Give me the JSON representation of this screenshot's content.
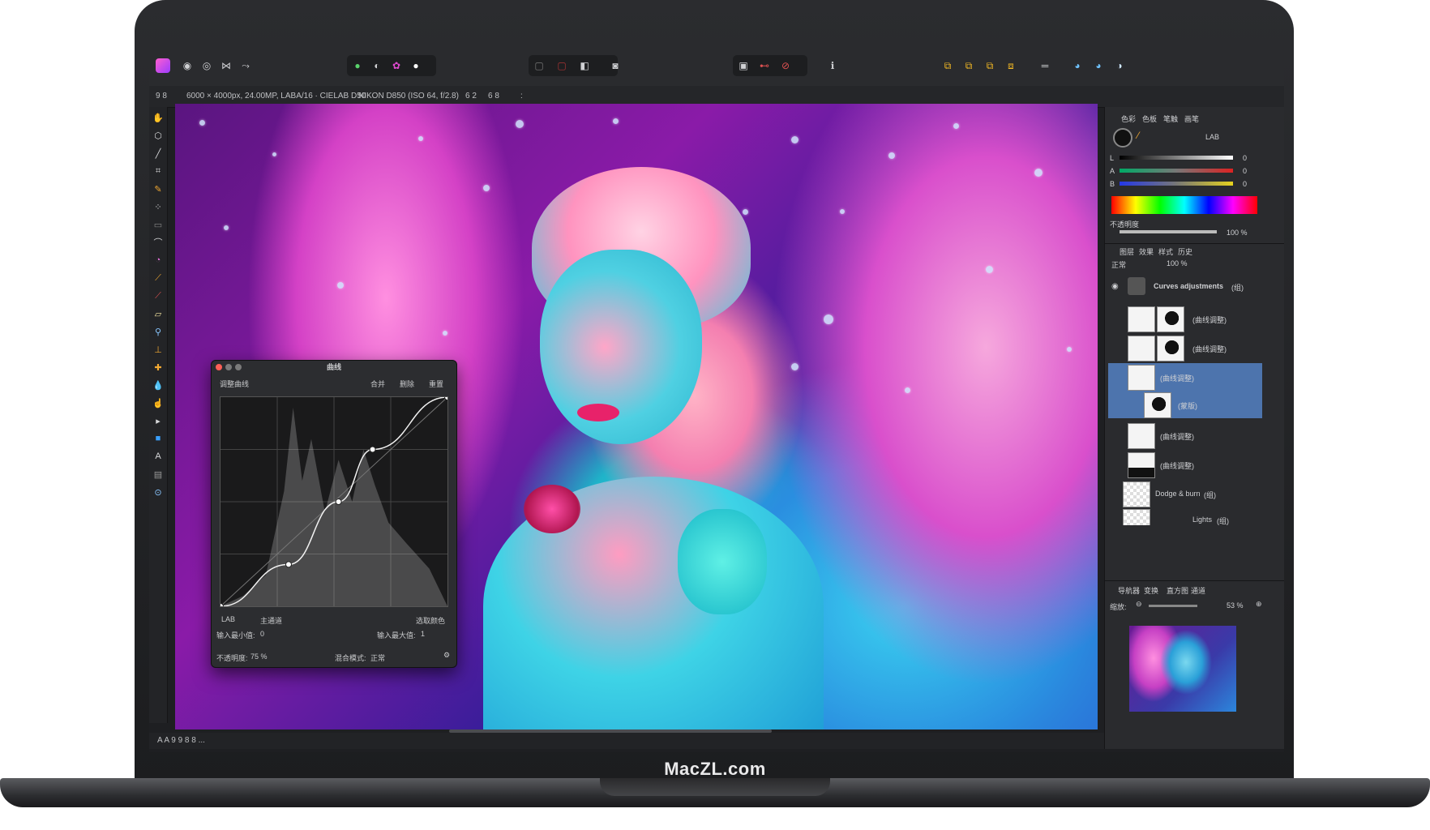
{
  "brand": "MacZL.com",
  "app": {
    "context_bar": {
      "items": [
        "9 8",
        "6000 × 4000px, 24.00MP, LABA/16 · CIELAB D50",
        "NIKON D850 (ISO 64, f/2.8)",
        "6 2",
        "6 8",
        ":"
      ]
    },
    "status_bar": "A A 9 9 8 8 ...",
    "curves_dialog": {
      "title": "曲线",
      "menu_left": "调整曲线",
      "menu_buttons": [
        "合并",
        "删除",
        "重置"
      ],
      "channel": "LAB",
      "channel_sub": "主通道",
      "picker_button": "选取颜色",
      "min_label": "输入最小值:",
      "min_value": "0",
      "max_label": "输入最大值:",
      "max_value": "1",
      "opacity_label": "不透明度:",
      "opacity_value": "75 %",
      "blend_label": "混合模式:",
      "blend_value": "正常",
      "traffic_colors": [
        "#ff5f56",
        "#7a7a7a",
        "#7a7a7a"
      ]
    },
    "color_panel": {
      "tabs": [
        "色彩",
        "色板",
        "笔触",
        "画笔"
      ],
      "mode": "LAB",
      "sliders": [
        {
          "label": "L",
          "value": "0"
        },
        {
          "label": "A",
          "value": "0"
        },
        {
          "label": "B",
          "value": "0"
        }
      ],
      "opacity_label": "不透明度",
      "opacity_value": "100 %"
    },
    "layers_panel": {
      "tabs": [
        "图层",
        "效果",
        "样式",
        "历史"
      ],
      "blend": "正常",
      "opacity": "100 %",
      "group_name": "Curves adjustments",
      "group_tag": "(组)",
      "layers": [
        {
          "name": "(曲线调整)"
        },
        {
          "name": "(曲线调整)"
        },
        {
          "name": "(曲线调整)",
          "selected": true
        },
        {
          "name": "(蒙版)",
          "selected": true
        },
        {
          "name": "(曲线调整)"
        },
        {
          "name": "(曲线调整)"
        },
        {
          "name": "Dodge & burn",
          "tag": "(组)"
        },
        {
          "name": "Lights",
          "tag": "(组)"
        }
      ]
    },
    "navigator_panel": {
      "tabs": [
        "导航器",
        "变换",
        "直方图",
        "通道"
      ],
      "zoom_label": "缩放:",
      "zoom_value": "53 %"
    },
    "chart_data": {
      "type": "line",
      "title": "",
      "xlabel": "",
      "ylabel": "",
      "xlim": [
        0,
        1
      ],
      "ylim": [
        0,
        1
      ],
      "series": [
        {
          "values": [
            [
              0,
              0
            ],
            [
              0.3,
              0.2
            ],
            [
              0.52,
              0.5
            ],
            [
              0.67,
              0.75
            ],
            [
              1,
              1
            ]
          ]
        }
      ]
    }
  }
}
